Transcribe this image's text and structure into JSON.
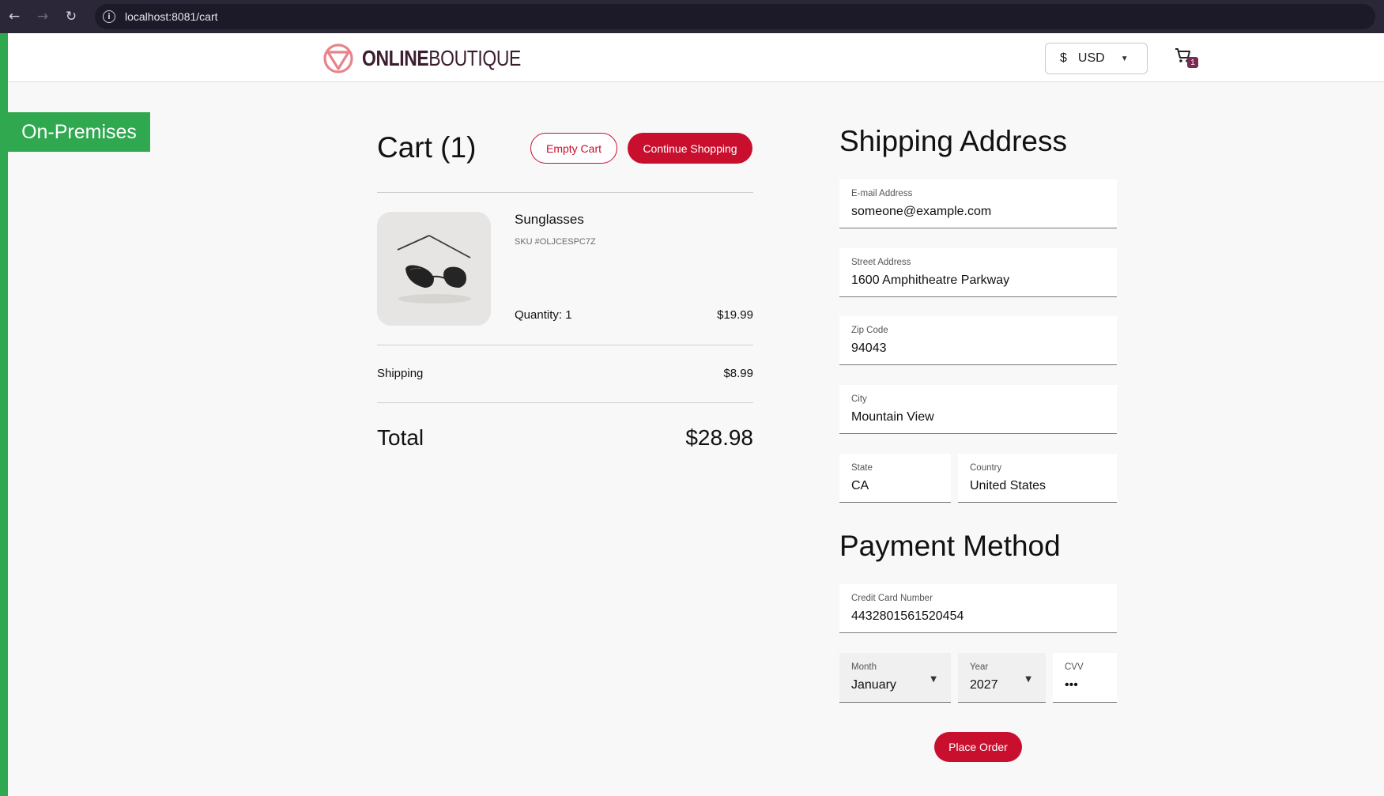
{
  "browser": {
    "back": "←",
    "forward": "→",
    "reload": "↻",
    "url": "localhost:8081/cart"
  },
  "env_badge": "On-Premises",
  "header": {
    "logo_bold": "ONLINE",
    "logo_light": "BOUTIQUE",
    "currency_symbol": "$",
    "currency": "USD",
    "cart_count": "1"
  },
  "cart": {
    "title": "Cart (1)",
    "empty_label": "Empty Cart",
    "continue_label": "Continue Shopping",
    "items": [
      {
        "name": "Sunglasses",
        "sku": "SKU #OLJCESPC7Z",
        "quantity": "Quantity: 1",
        "price": "$19.99"
      }
    ],
    "shipping_label": "Shipping",
    "shipping_value": "$8.99",
    "total_label": "Total",
    "total_value": "$28.98"
  },
  "shipping": {
    "title": "Shipping Address",
    "email_label": "E-mail Address",
    "email": "someone@example.com",
    "street_label": "Street Address",
    "street": "1600 Amphitheatre Parkway",
    "zip_label": "Zip Code",
    "zip": "94043",
    "city_label": "City",
    "city": "Mountain View",
    "state_label": "State",
    "state": "CA",
    "country_label": "Country",
    "country": "United States"
  },
  "payment": {
    "title": "Payment Method",
    "card_label": "Credit Card Number",
    "card": "4432801561520454",
    "month_label": "Month",
    "month": "January",
    "year_label": "Year",
    "year": "2027",
    "cvv_label": "CVV",
    "cvv": "•••",
    "place_order": "Place Order"
  },
  "colors": {
    "brand": "#c8102e",
    "env": "#2fa84f",
    "logo_text": "#3b1d2f"
  }
}
